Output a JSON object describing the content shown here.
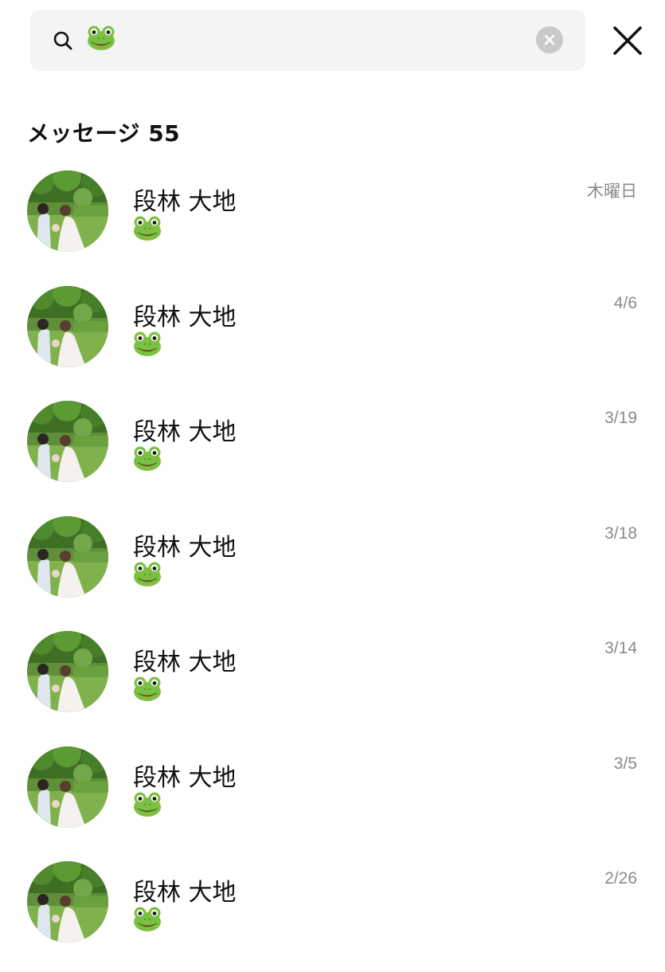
{
  "search": {
    "value_icon": "frog-emoji",
    "clear_icon": "clear-circle-icon"
  },
  "close_icon": "close-x-icon",
  "section": {
    "title": "メッセージ 55"
  },
  "colors": {
    "search_bg": "#f4f4f4",
    "date_text": "#8a8a8a",
    "frog_green": "#7cc043"
  },
  "results": [
    {
      "name": "段林 大地",
      "message_icon": "frog-emoji",
      "date": "木曜日"
    },
    {
      "name": "段林 大地",
      "message_icon": "frog-emoji",
      "date": "4/6"
    },
    {
      "name": "段林 大地",
      "message_icon": "frog-emoji",
      "date": "3/19"
    },
    {
      "name": "段林 大地",
      "message_icon": "frog-emoji",
      "date": "3/18"
    },
    {
      "name": "段林 大地",
      "message_icon": "frog-emoji",
      "date": "3/14"
    },
    {
      "name": "段林 大地",
      "message_icon": "frog-emoji",
      "date": "3/5"
    },
    {
      "name": "段林 大地",
      "message_icon": "frog-emoji",
      "date": "2/26"
    }
  ]
}
